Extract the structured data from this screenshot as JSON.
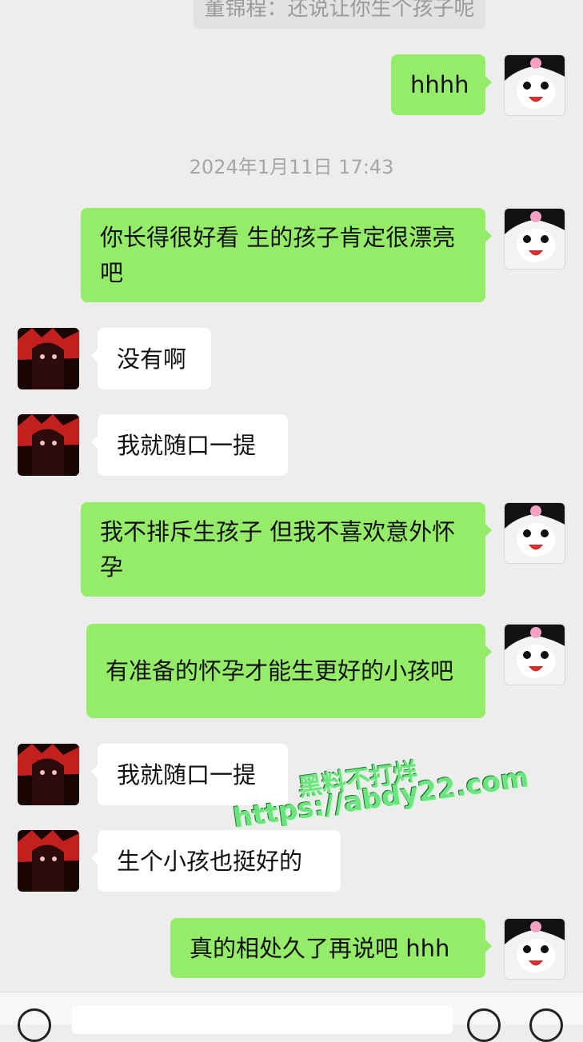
{
  "quote_preview": "董锦程：还说让你生个孩子呢",
  "timestamp": "2024年1月11日 17:43",
  "messages": [
    {
      "side": "self",
      "text": "hhhh"
    },
    {
      "side": "self",
      "text": "你长得很好看 生的孩子肯定很漂亮吧"
    },
    {
      "side": "other",
      "text": "没有啊"
    },
    {
      "side": "other",
      "text": "我就随口一提"
    },
    {
      "side": "self",
      "text": "我不排斥生孩子 但我不喜欢意外怀孕"
    },
    {
      "side": "self",
      "text": "有准备的怀孕才能生更好的小孩吧"
    },
    {
      "side": "other",
      "text": "我就随口一提"
    },
    {
      "side": "other",
      "text": "生个小孩也挺好的"
    },
    {
      "side": "self",
      "text": "真的相处久了再说吧 hhh"
    }
  ],
  "watermark": {
    "line1": "黑料不打烊",
    "line2": "https://abdy22.com"
  }
}
